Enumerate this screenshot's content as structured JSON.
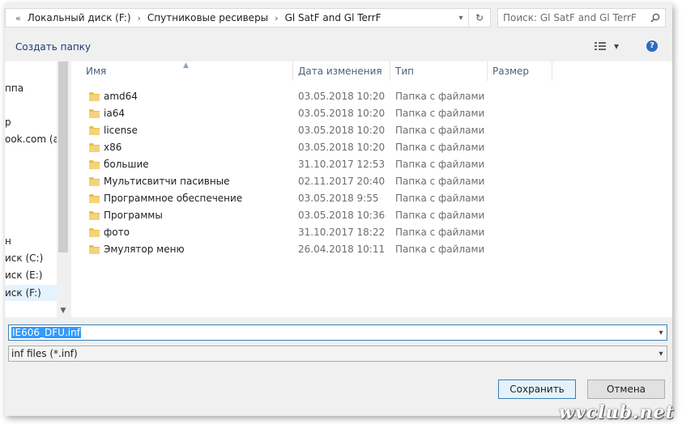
{
  "address_bar": {
    "overflow": "«",
    "breadcrumbs": [
      "Локальный диск (F:)",
      "Спутниковые ресиверы",
      "Gl SatF and Gl TerrF"
    ],
    "dropdown": "▾",
    "refresh": "↻"
  },
  "search": {
    "placeholder": "Поиск: Gl SatF and Gl TerrF",
    "icon": "search-icon"
  },
  "toolbar": {
    "new_folder": "Создать папку",
    "view_dropdown": "▾",
    "help": "?"
  },
  "nav_pane": {
    "items": [
      "ппа",
      "р",
      "ook.com (a",
      "н",
      "иск (C:)",
      "иск (E:)",
      "иск (F:)"
    ],
    "selected": "иск (F:)"
  },
  "file_list": {
    "columns": [
      "Имя",
      "Дата изменения",
      "Тип",
      "Размер"
    ],
    "sort_column": "Имя",
    "rows": [
      {
        "name": "amd64",
        "date": "03.05.2018 10:20",
        "type": "Папка с файлами"
      },
      {
        "name": "ia64",
        "date": "03.05.2018 10:20",
        "type": "Папка с файлами"
      },
      {
        "name": "license",
        "date": "03.05.2018 10:20",
        "type": "Папка с файлами"
      },
      {
        "name": "x86",
        "date": "03.05.2018 10:20",
        "type": "Папка с файлами"
      },
      {
        "name": "большие",
        "date": "31.10.2017 12:53",
        "type": "Папка с файлами"
      },
      {
        "name": "Мультисвитчи пасивные",
        "date": "02.11.2017 20:40",
        "type": "Папка с файлами"
      },
      {
        "name": "Программное обеспечение",
        "date": "03.05.2018 9:55",
        "type": "Папка с файлами"
      },
      {
        "name": "Программы",
        "date": "03.05.2018 10:36",
        "type": "Папка с файлами"
      },
      {
        "name": "фото",
        "date": "31.10.2017 18:22",
        "type": "Папка с файлами"
      },
      {
        "name": "Эмулятор меню",
        "date": "26.04.2018 10:11",
        "type": "Папка с файлами"
      }
    ]
  },
  "file_name": {
    "value": "IE606_DFU.inf"
  },
  "file_type": {
    "value": "inf files (*.inf)"
  },
  "buttons": {
    "save": "Сохранить",
    "cancel": "Отмена"
  },
  "watermark": "wvclub.net",
  "colors": {
    "folder": "#e8c04a",
    "selection": "#3399ff",
    "accent_border": "#3c7fb1"
  }
}
